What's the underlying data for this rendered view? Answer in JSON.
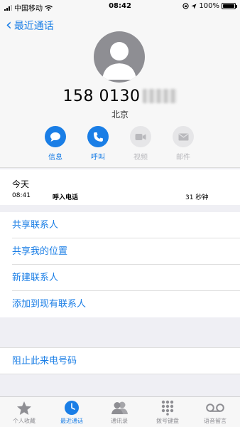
{
  "status_bar": {
    "carrier": "中国移动",
    "time": "08:42",
    "battery": "100%",
    "battery_level": 1.0
  },
  "nav": {
    "back_label": "最近通话"
  },
  "contact": {
    "number_visible": "158 0130",
    "location": "北京"
  },
  "actions": [
    {
      "label": "信息",
      "icon": "message-icon",
      "enabled": true
    },
    {
      "label": "呼叫",
      "icon": "phone-icon",
      "enabled": true
    },
    {
      "label": "视频",
      "icon": "video-icon",
      "enabled": false
    },
    {
      "label": "邮件",
      "icon": "mail-icon",
      "enabled": false
    }
  ],
  "call_log": {
    "day": "今天",
    "time": "08:41",
    "type": "呼入电话",
    "duration": "31 秒钟"
  },
  "menu": {
    "items": [
      "共享联系人",
      "共享我的位置",
      "新建联系人",
      "添加到现有联系人"
    ],
    "block_label": "阻止此来电号码"
  },
  "tabs": [
    {
      "label": "个人收藏",
      "icon": "star-icon"
    },
    {
      "label": "最近通话",
      "icon": "clock-icon",
      "selected": true
    },
    {
      "label": "通讯录",
      "icon": "contacts-icon"
    },
    {
      "label": "拨号键盘",
      "icon": "keypad-icon"
    },
    {
      "label": "语音留言",
      "icon": "voicemail-icon"
    }
  ],
  "colors": {
    "accent": "#1a7ee6",
    "avatar": "#8e8e93",
    "disabled": "#e6e6e8"
  }
}
